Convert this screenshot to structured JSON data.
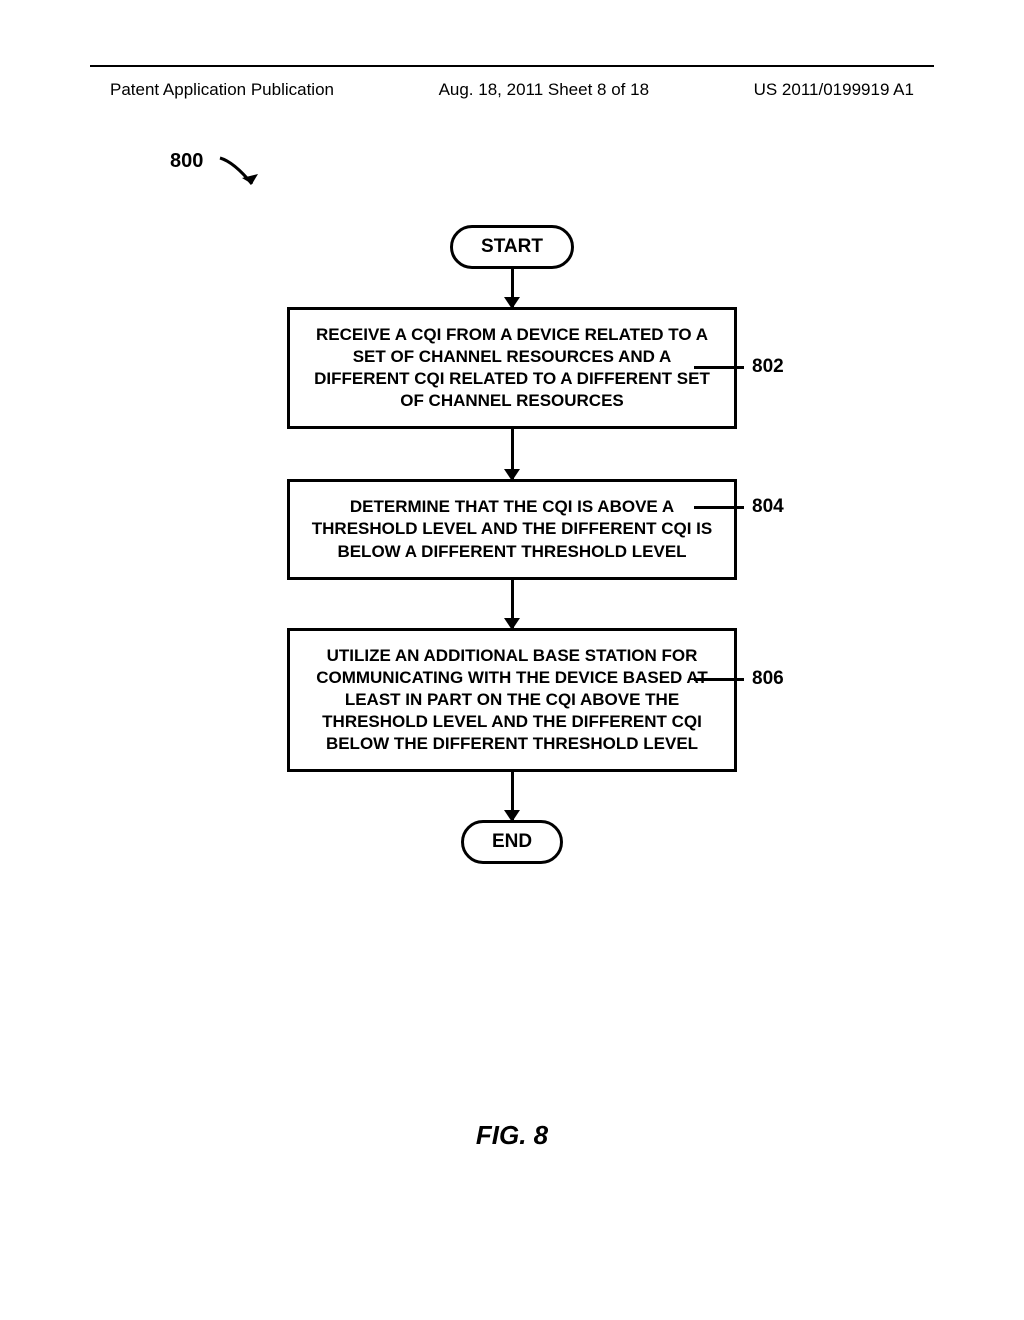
{
  "header": {
    "left": "Patent Application Publication",
    "center": "Aug. 18, 2011  Sheet 8 of 18",
    "right": "US 2011/0199919 A1"
  },
  "figure_ref": "800",
  "flow": {
    "start": "START",
    "step1": {
      "text": "RECEIVE A CQI FROM A DEVICE RELATED TO A SET OF CHANNEL RESOURCES AND A DIFFERENT CQI RELATED TO A DIFFERENT SET OF CHANNEL RESOURCES",
      "ref": "802"
    },
    "step2": {
      "text": "DETERMINE THAT THE CQI IS ABOVE A THRESHOLD LEVEL AND THE DIFFERENT CQI IS BELOW A DIFFERENT THRESHOLD LEVEL",
      "ref": "804"
    },
    "step3": {
      "text": "UTILIZE AN ADDITIONAL BASE STATION FOR COMMUNICATING WITH THE DEVICE BASED AT LEAST IN PART ON THE CQI ABOVE THE THRESHOLD LEVEL AND THE DIFFERENT CQI BELOW THE DIFFERENT THRESHOLD LEVEL",
      "ref": "806"
    },
    "end": "END"
  },
  "caption": "FIG. 8"
}
